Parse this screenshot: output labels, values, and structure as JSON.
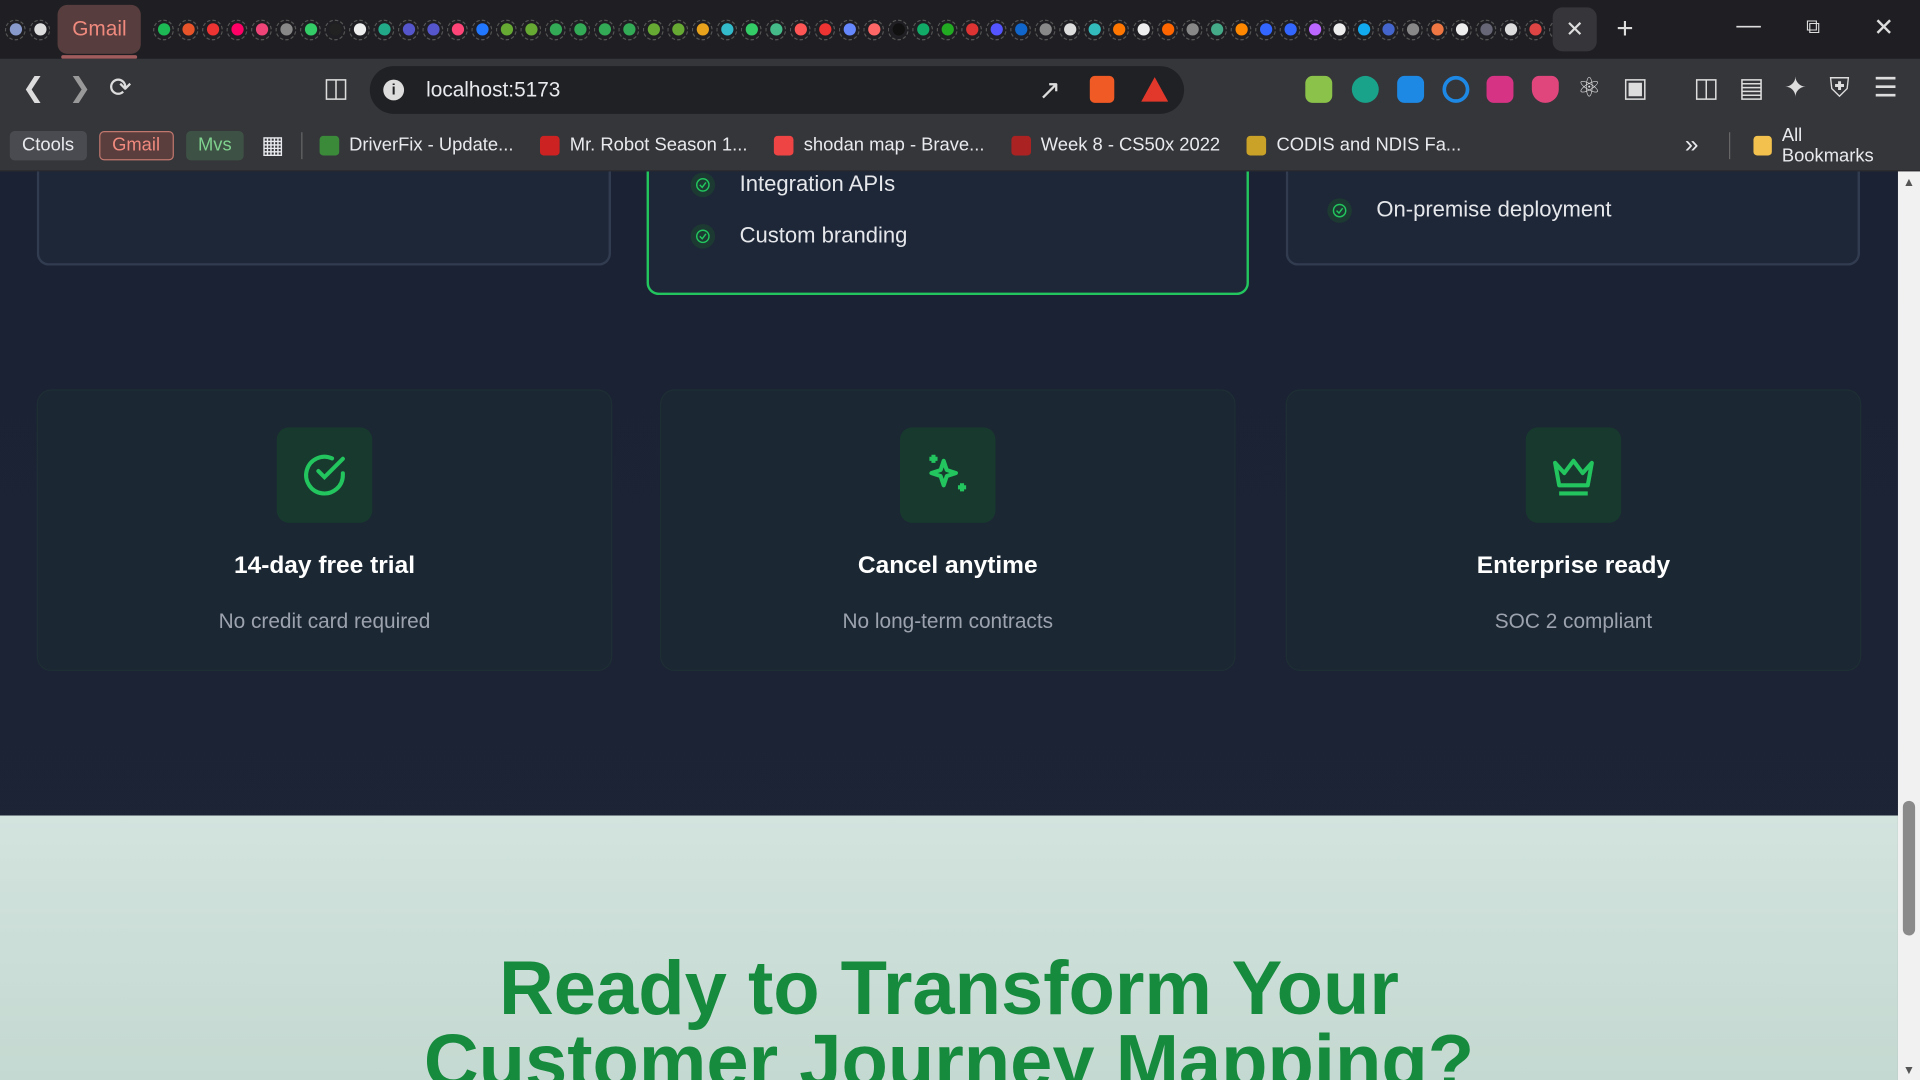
{
  "browser": {
    "pinned_tab_colors": [
      "#8899cc",
      "#dddddd",
      "#1db954",
      "#e8542a",
      "#e33",
      "#f06",
      "#e47",
      "#888",
      "#3c6",
      "#222",
      "#eee",
      "#2a8",
      "#55c",
      "#55c",
      "#f47",
      "#27f",
      "#6a3",
      "#6a3",
      "#3a5",
      "#3a5",
      "#3a5",
      "#3a5",
      "#6a3",
      "#6a3",
      "#e9a21b",
      "#3bc",
      "#3c6",
      "#4b8",
      "#f55",
      "#e33",
      "#68f",
      "#f66",
      "#111",
      "#1a6",
      "#2a2",
      "#d33",
      "#55f",
      "#16c",
      "#888",
      "#ddd",
      "#3bb",
      "#f70",
      "#eee",
      "#f60",
      "#888",
      "#4a8",
      "#f80",
      "#36f",
      "#36f",
      "#b6f",
      "#eee",
      "#1ae",
      "#46c",
      "#888",
      "#e74",
      "#eee",
      "#667",
      "#ddd",
      "#d44",
      "#55f",
      "#eee"
    ],
    "active_tab_label": "Gmail",
    "close_tab_label": "✕",
    "new_tab_label": "+",
    "url": "localhost:5173",
    "bookmarks_chips": [
      {
        "label": "Ctools",
        "bg": "#4a4b50",
        "color": "#e8eaed"
      },
      {
        "label": "Gmail",
        "bg": "#5a3d3d",
        "color": "#f08a7e"
      },
      {
        "label": "Mvs",
        "bg": "#3d5245",
        "color": "#7fd08e"
      }
    ],
    "bookmarks": [
      {
        "label": "DriverFix - Update...",
        "color": "#3a8a3a"
      },
      {
        "label": "Mr. Robot Season 1...",
        "color": "#c22"
      },
      {
        "label": "shodan map - Brave...",
        "color": "#e44"
      },
      {
        "label": "Week 8 - CS50x 2022",
        "color": "#a22"
      },
      {
        "label": "CODIS and NDIS Fa...",
        "color": "#c9a227"
      }
    ],
    "more_label": "»",
    "all_bookmarks_label": "All Bookmarks"
  },
  "plans": {
    "middle_features": [
      "Integration APIs",
      "Custom branding"
    ],
    "right_features": [
      "On-premise deployment"
    ]
  },
  "benefits": [
    {
      "icon": "check-circle",
      "title": "14-day free trial",
      "subtitle": "No credit card required"
    },
    {
      "icon": "sparkles",
      "title": "Cancel anytime",
      "subtitle": "No long-term contracts"
    },
    {
      "icon": "crown",
      "title": "Enterprise ready",
      "subtitle": "SOC 2 compliant"
    }
  ],
  "cta": {
    "headline": "Ready to Transform Your Customer Journey Mapping?"
  },
  "colors": {
    "accent": "#22c55e",
    "page_bg": "#1b2333",
    "cta_bg": "#cfe0da"
  }
}
